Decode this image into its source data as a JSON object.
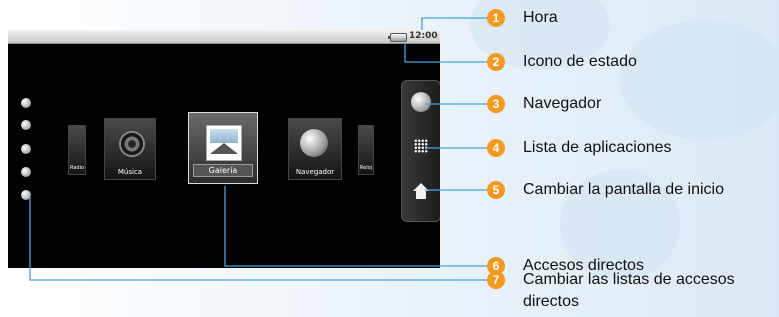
{
  "status_bar": {
    "time": "12:00"
  },
  "shortcuts": {
    "tiles": [
      {
        "label": "Radio"
      },
      {
        "label": "Música"
      },
      {
        "label": "Galería"
      },
      {
        "label": "Navegador"
      },
      {
        "label": "Reloj"
      }
    ],
    "selected": "Galería"
  },
  "list_dots_count": 5,
  "dock": {
    "items": [
      "browser",
      "app-list",
      "home"
    ]
  },
  "callouts": [
    {
      "number": "1",
      "label": "Hora"
    },
    {
      "number": "2",
      "label": "Icono de estado"
    },
    {
      "number": "3",
      "label": "Navegador"
    },
    {
      "number": "4",
      "label": "Lista de aplicaciones"
    },
    {
      "number": "5",
      "label": "Cambiar la pantalla de inicio"
    },
    {
      "number": "6",
      "label": "Accesos directos"
    },
    {
      "number": "7",
      "label": "Cambiar las listas de accesos",
      "label2": "directos"
    }
  ],
  "colors": {
    "callout_badge": "#f39a1f",
    "leader_line": "#4aa3df"
  }
}
